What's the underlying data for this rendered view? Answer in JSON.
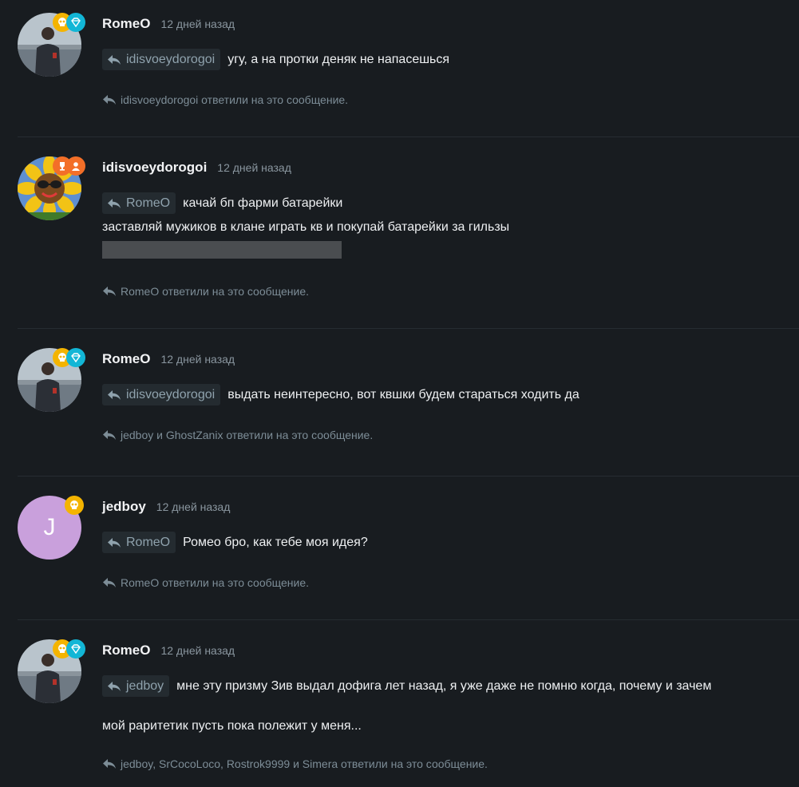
{
  "posts": [
    {
      "username": "RomeO",
      "time": "12 дней назад",
      "reply_to": "idisvoeydorogoi",
      "text": "угу, а на протки деняк не напасешься",
      "replied_by": "idisvoeydorogoi ответили на это сообщение.",
      "avatar": "photo-man",
      "badges": [
        "skull-badge-icon",
        "diamond-badge-icon"
      ]
    },
    {
      "username": "idisvoeydorogoi",
      "time": "12 дней назад",
      "reply_to": "RomeO",
      "text": "качай бп фарми батарейки",
      "text2": "заставляй мужиков в клане играть кв и покупай батарейки за гильзы",
      "replied_by": "RomeO ответили на это сообщение.",
      "avatar": "sunflower-sunglasses",
      "badges": [
        "trophy-badge-icon",
        "users-badge-icon"
      ]
    },
    {
      "username": "RomeO",
      "time": "12 дней назад",
      "reply_to": "idisvoeydorogoi",
      "text": "выдать неинтересно, вот квшки будем стараться ходить да",
      "replied_by": "jedboy и GhostZanix ответили на это сообщение.",
      "avatar": "photo-man",
      "badges": [
        "skull-badge-icon",
        "diamond-badge-icon"
      ]
    },
    {
      "username": "jedboy",
      "time": "12 дней назад",
      "reply_to": "RomeO",
      "text": "Ромео бро, как тебе моя идея?",
      "replied_by": "RomeO ответили на это сообщение.",
      "avatar_letter": "J",
      "badges": [
        "skull-badge-icon"
      ]
    },
    {
      "username": "RomeO",
      "time": "12 дней назад",
      "reply_to": "jedboy",
      "text": "мне эту призму Зив выдал дофига лет назад, я уже даже не помню когда, почему и зачем",
      "text2": "мой раритетик пусть пока полежит у меня...",
      "replied_by": "jedboy, SrCocoLoco, Rostrok9999 и Simera ответили на это сообщение.",
      "avatar": "photo-man",
      "badges": [
        "skull-badge-icon",
        "diamond-badge-icon"
      ]
    }
  ],
  "colors": {
    "background": "#181c20",
    "chip_bg": "#242b30",
    "chip_text": "#8fa2ad",
    "muted": "#7d8d97",
    "gold_badge": "#f4b400",
    "cyan_badge": "#12b6d6",
    "orange_badge": "#f36f28",
    "letter_avatar": "#c9a0dc"
  }
}
